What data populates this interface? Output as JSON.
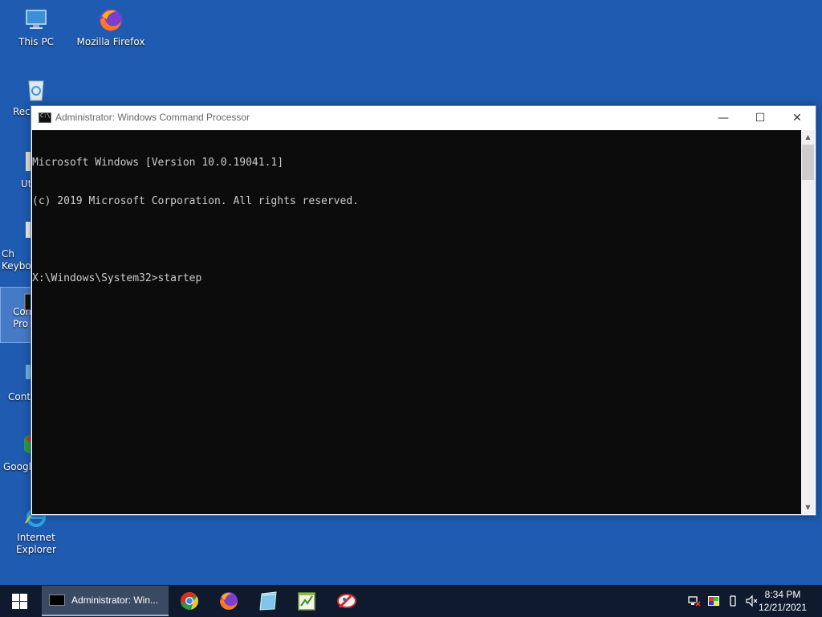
{
  "desktop": {
    "icons": [
      {
        "label": "This PC",
        "icon": "computer-icon"
      },
      {
        "label": "Mozilla Firefox",
        "icon": "firefox-icon"
      },
      {
        "label": "Recy",
        "icon": "recycle-bin-icon"
      },
      {
        "label": "Ut",
        "icon": "utility-icon"
      },
      {
        "label": "Ch\nKeyboa",
        "icon": "keyboard-icon"
      },
      {
        "label": "Com\nPro",
        "icon": "command-prompt-icon"
      },
      {
        "label": "Contr",
        "icon": "control-panel-icon"
      },
      {
        "label": "Google",
        "icon": "chrome-icon"
      },
      {
        "label": "Internet Explorer",
        "icon": "ie-icon"
      }
    ]
  },
  "window": {
    "title": "Administrator: Windows Command Processor",
    "minimize_glyph": "—",
    "maximize_glyph": "☐",
    "close_glyph": "✕",
    "console_lines": [
      "Microsoft Windows [Version 10.0.19041.1]",
      "(c) 2019 Microsoft Corporation. All rights reserved.",
      "",
      "X:\\Windows\\System32>startep"
    ]
  },
  "taskbar": {
    "active_task_label": "Administrator: Win...",
    "pinned_apps": [
      "chrome-icon",
      "firefox-icon",
      "notepad-icon",
      "text-editor-icon",
      "paint-icon"
    ],
    "tray_icons": [
      "network-icon",
      "color-icon",
      "usb-icon",
      "volume-icon"
    ],
    "clock_time": "8:34 PM",
    "clock_date": "12/21/2021"
  },
  "colors": {
    "desktop": "#1f5bb0",
    "taskbar": "#101a2e",
    "console_bg": "#0c0c0c",
    "console_fg": "#cccccc"
  }
}
